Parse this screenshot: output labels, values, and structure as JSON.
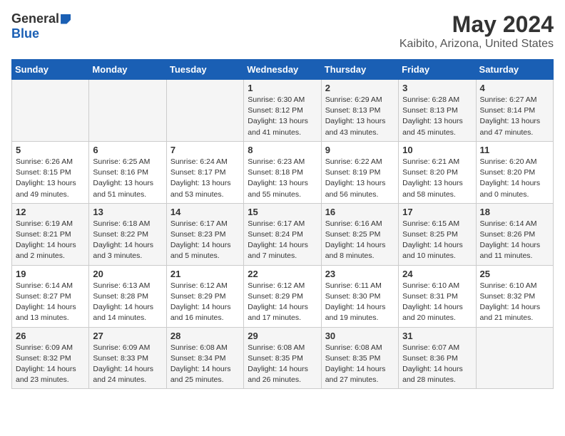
{
  "logo": {
    "general": "General",
    "blue": "Blue"
  },
  "title": "May 2024",
  "subtitle": "Kaibito, Arizona, United States",
  "days_of_week": [
    "Sunday",
    "Monday",
    "Tuesday",
    "Wednesday",
    "Thursday",
    "Friday",
    "Saturday"
  ],
  "weeks": [
    [
      {
        "day": "",
        "info": ""
      },
      {
        "day": "",
        "info": ""
      },
      {
        "day": "",
        "info": ""
      },
      {
        "day": "1",
        "info": "Sunrise: 6:30 AM\nSunset: 8:12 PM\nDaylight: 13 hours\nand 41 minutes."
      },
      {
        "day": "2",
        "info": "Sunrise: 6:29 AM\nSunset: 8:13 PM\nDaylight: 13 hours\nand 43 minutes."
      },
      {
        "day": "3",
        "info": "Sunrise: 6:28 AM\nSunset: 8:13 PM\nDaylight: 13 hours\nand 45 minutes."
      },
      {
        "day": "4",
        "info": "Sunrise: 6:27 AM\nSunset: 8:14 PM\nDaylight: 13 hours\nand 47 minutes."
      }
    ],
    [
      {
        "day": "5",
        "info": "Sunrise: 6:26 AM\nSunset: 8:15 PM\nDaylight: 13 hours\nand 49 minutes."
      },
      {
        "day": "6",
        "info": "Sunrise: 6:25 AM\nSunset: 8:16 PM\nDaylight: 13 hours\nand 51 minutes."
      },
      {
        "day": "7",
        "info": "Sunrise: 6:24 AM\nSunset: 8:17 PM\nDaylight: 13 hours\nand 53 minutes."
      },
      {
        "day": "8",
        "info": "Sunrise: 6:23 AM\nSunset: 8:18 PM\nDaylight: 13 hours\nand 55 minutes."
      },
      {
        "day": "9",
        "info": "Sunrise: 6:22 AM\nSunset: 8:19 PM\nDaylight: 13 hours\nand 56 minutes."
      },
      {
        "day": "10",
        "info": "Sunrise: 6:21 AM\nSunset: 8:20 PM\nDaylight: 13 hours\nand 58 minutes."
      },
      {
        "day": "11",
        "info": "Sunrise: 6:20 AM\nSunset: 8:20 PM\nDaylight: 14 hours\nand 0 minutes."
      }
    ],
    [
      {
        "day": "12",
        "info": "Sunrise: 6:19 AM\nSunset: 8:21 PM\nDaylight: 14 hours\nand 2 minutes."
      },
      {
        "day": "13",
        "info": "Sunrise: 6:18 AM\nSunset: 8:22 PM\nDaylight: 14 hours\nand 3 minutes."
      },
      {
        "day": "14",
        "info": "Sunrise: 6:17 AM\nSunset: 8:23 PM\nDaylight: 14 hours\nand 5 minutes."
      },
      {
        "day": "15",
        "info": "Sunrise: 6:17 AM\nSunset: 8:24 PM\nDaylight: 14 hours\nand 7 minutes."
      },
      {
        "day": "16",
        "info": "Sunrise: 6:16 AM\nSunset: 8:25 PM\nDaylight: 14 hours\nand 8 minutes."
      },
      {
        "day": "17",
        "info": "Sunrise: 6:15 AM\nSunset: 8:25 PM\nDaylight: 14 hours\nand 10 minutes."
      },
      {
        "day": "18",
        "info": "Sunrise: 6:14 AM\nSunset: 8:26 PM\nDaylight: 14 hours\nand 11 minutes."
      }
    ],
    [
      {
        "day": "19",
        "info": "Sunrise: 6:14 AM\nSunset: 8:27 PM\nDaylight: 14 hours\nand 13 minutes."
      },
      {
        "day": "20",
        "info": "Sunrise: 6:13 AM\nSunset: 8:28 PM\nDaylight: 14 hours\nand 14 minutes."
      },
      {
        "day": "21",
        "info": "Sunrise: 6:12 AM\nSunset: 8:29 PM\nDaylight: 14 hours\nand 16 minutes."
      },
      {
        "day": "22",
        "info": "Sunrise: 6:12 AM\nSunset: 8:29 PM\nDaylight: 14 hours\nand 17 minutes."
      },
      {
        "day": "23",
        "info": "Sunrise: 6:11 AM\nSunset: 8:30 PM\nDaylight: 14 hours\nand 19 minutes."
      },
      {
        "day": "24",
        "info": "Sunrise: 6:10 AM\nSunset: 8:31 PM\nDaylight: 14 hours\nand 20 minutes."
      },
      {
        "day": "25",
        "info": "Sunrise: 6:10 AM\nSunset: 8:32 PM\nDaylight: 14 hours\nand 21 minutes."
      }
    ],
    [
      {
        "day": "26",
        "info": "Sunrise: 6:09 AM\nSunset: 8:32 PM\nDaylight: 14 hours\nand 23 minutes."
      },
      {
        "day": "27",
        "info": "Sunrise: 6:09 AM\nSunset: 8:33 PM\nDaylight: 14 hours\nand 24 minutes."
      },
      {
        "day": "28",
        "info": "Sunrise: 6:08 AM\nSunset: 8:34 PM\nDaylight: 14 hours\nand 25 minutes."
      },
      {
        "day": "29",
        "info": "Sunrise: 6:08 AM\nSunset: 8:35 PM\nDaylight: 14 hours\nand 26 minutes."
      },
      {
        "day": "30",
        "info": "Sunrise: 6:08 AM\nSunset: 8:35 PM\nDaylight: 14 hours\nand 27 minutes."
      },
      {
        "day": "31",
        "info": "Sunrise: 6:07 AM\nSunset: 8:36 PM\nDaylight: 14 hours\nand 28 minutes."
      },
      {
        "day": "",
        "info": ""
      }
    ]
  ]
}
